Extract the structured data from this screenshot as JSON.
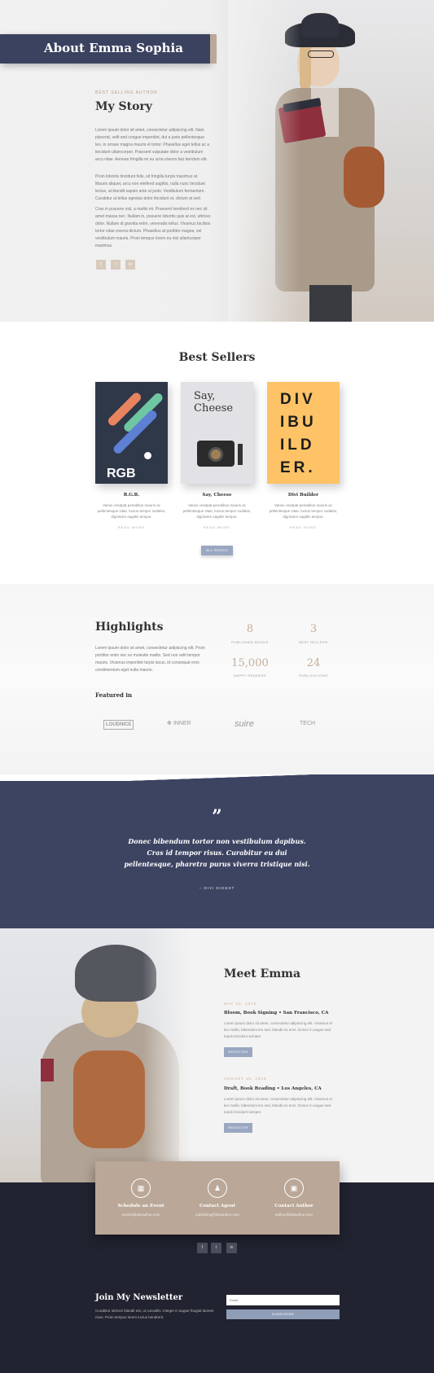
{
  "hero": {
    "title": "About Emma Sophia",
    "eyebrow": "BEST SELLING AUTHOR",
    "heading": "My Story",
    "paragraphs": [
      "Lorem ipsum dolor sit amet, consectetur adipiscing elit. Nam placerat, velit sed congue imperdiet, dui a justo pellentesque leo, in ornare magna mauris et tortor. Phasellus eget tellus ac a tincidunt ullamcorper. Praesent vulputate dolor a vestibulum arcu vitae. Aenean fringilla mi eu urna viverra faci bendum elit.",
      "Proin lobortis tincidunt felis, sit fringilla turpis maximus at. Mauris aliquet, arcu non eleifend sagittis, nulla nunc tincidunt lectus, at blandit sapien ante ut justo. Vestibulum fermentum. Curabitur ut tellus egestas dolor tincidunt et, dictum at sed.",
      "Cras in posuere nisl, a mattis mi. Praesent hendrerit ex nec sit amet massa nec. Nullam in, posuere lobortis quis at est, ultrices dolor. Nullam id gravida enim, venenatis tellus. Vivamus facilisis tortor vitae viverra dictum. Phasellus at porttitor magna, vel vestibulum mauris. Proin tempus lorem eu nisl ullamcorper maximus."
    ],
    "social_icons": [
      "facebook-icon",
      "twitter-icon",
      "linkedin-icon"
    ],
    "social_glyphs": [
      "f",
      "t",
      "in"
    ]
  },
  "best_sellers": {
    "title": "Best Sellers",
    "books": [
      {
        "title": "R.G.B.",
        "desc": "Varius volutpat penatibus mauris ac pellentesque vitae, luctus tempor sodales, dignissim sagittis tempor.",
        "link": "READ MORE",
        "cover_text": "RGB"
      },
      {
        "title": "Say, Cheese",
        "desc": "Varius volutpat penatibus mauris ac pellentesque vitae, luctus tempor sodales, dignissim sagittis tempor.",
        "link": "READ MORE",
        "cover_text": "Say, Cheese"
      },
      {
        "title": "Divi Builder",
        "desc": "Varius volutpat penatibus mauris ac pellentesque vitae, luctus tempor sodales, dignissim sagittis tempor.",
        "link": "READ MORE",
        "cover_text": "DIV IBU ILD ER."
      }
    ],
    "all_books_button": "ALL BOOKS"
  },
  "highlights": {
    "title": "Highlights",
    "text": "Lorem ipsum dolor sit amet, consectetur adipiscing elit. Proin porttitor enim nec ex molestie mattis. Sed non velit tempor mauris. Vivamus imperdiet turpis lacus, id consequat eros condimentum eget nulla mauris.",
    "stats": [
      {
        "value": "8",
        "label": "PUBLISHED BOOKS"
      },
      {
        "value": "3",
        "label": "BEST SELLERS"
      },
      {
        "value": "15,000",
        "label": "HAPPY READERS"
      },
      {
        "value": "24",
        "label": "PUBLICATIONS"
      }
    ],
    "featured_label": "Featured in",
    "logos": [
      "LOUDNICE",
      "INNER",
      "suire",
      "TECH"
    ]
  },
  "quote": {
    "mark": "”",
    "text": "Donec bibendum tortor non vestibulum dapibus. Cras id tempor risus. Curabitur eu dui pellentesque, pharetra purus viverra tristique nisi.",
    "source": "– DIVI DIGEST"
  },
  "meet": {
    "title": "Meet Emma",
    "events": [
      {
        "date": "MAY 20, 2018",
        "title": "Bloom, Book Signing • San Francisco, CA",
        "text": "Lorem ipsum dolor sit amet, consectetur adipiscing elit. Vivamus et leo mollis, bibendum leo sed, blandit ex eros. Donec in augue sed turpis tincidunt semper.",
        "button": "REGISTER"
      },
      {
        "date": "AUGUST 16, 2018",
        "title": "Draft, Book Reading • Los Angeles, CA",
        "text": "Lorem ipsum dolor sit amet, consectetur adipiscing elit. Vivamus et leo mollis, bibendum leo sed, blandit ex eros. Donec in augue sed turpis tincidunt semper.",
        "button": "REGISTER"
      }
    ]
  },
  "contact": {
    "items": [
      {
        "icon": "calendar-icon",
        "glyph": "▦",
        "label": "Schedule an Event",
        "sub": "events@diviauthor.com"
      },
      {
        "icon": "person-icon",
        "glyph": "♟",
        "label": "Contact Agent",
        "sub": "publishing@diviauthor.com"
      },
      {
        "icon": "book-icon",
        "glyph": "▣",
        "label": "Contact Author",
        "sub": "author@diviauthor.com"
      }
    ],
    "social_icons": [
      "facebook-icon",
      "twitter-icon",
      "linkedin-icon"
    ],
    "social_glyphs": [
      "f",
      "t",
      "in"
    ]
  },
  "newsletter": {
    "title": "Join My Newsletter",
    "text": "Curabitur ultrices blandit est, ut convallis. Integer in augue feugiat laoreet risus. Proin tempus lorem luctus hendrerit.",
    "email_placeholder": "Email",
    "button": "SUBSCRIBE"
  },
  "colors": {
    "navy": "#3d4462",
    "tan": "#baa797",
    "footer": "#212330",
    "button": "#9aa7c1"
  }
}
